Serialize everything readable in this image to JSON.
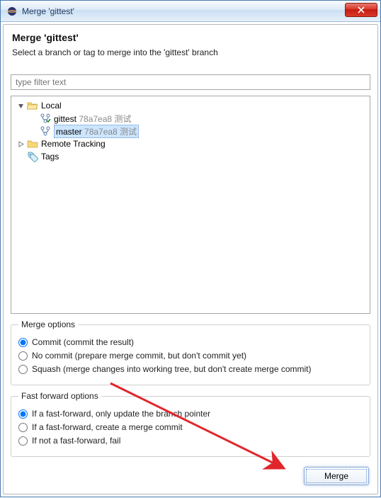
{
  "window": {
    "title": "Merge 'gittest'"
  },
  "header": {
    "title": "Merge 'gittest'",
    "description": "Select a branch or tag to merge into the 'gittest' branch"
  },
  "filter": {
    "placeholder": "type filter text"
  },
  "tree": {
    "local": {
      "label": "Local",
      "branches": [
        {
          "name": "gittest",
          "hash": "78a7ea8",
          "msg": "测试",
          "selected": false
        },
        {
          "name": "master",
          "hash": "78a7ea8",
          "msg": "测试",
          "selected": true
        }
      ]
    },
    "remote": {
      "label": "Remote Tracking"
    },
    "tags": {
      "label": "Tags"
    }
  },
  "merge_options": {
    "legend": "Merge options",
    "items": [
      {
        "label": "Commit (commit the result)",
        "checked": true
      },
      {
        "label": "No commit (prepare merge commit, but don't commit yet)",
        "checked": false
      },
      {
        "label": "Squash (merge changes into working tree, but don't create merge commit)",
        "checked": false
      }
    ]
  },
  "ff_options": {
    "legend": "Fast forward options",
    "items": [
      {
        "label": "If a fast-forward, only update the branch pointer",
        "checked": true
      },
      {
        "label": "If a fast-forward, create a merge commit",
        "checked": false
      },
      {
        "label": "If not a fast-forward, fail",
        "checked": false
      }
    ]
  },
  "buttons": {
    "merge": "Merge"
  }
}
